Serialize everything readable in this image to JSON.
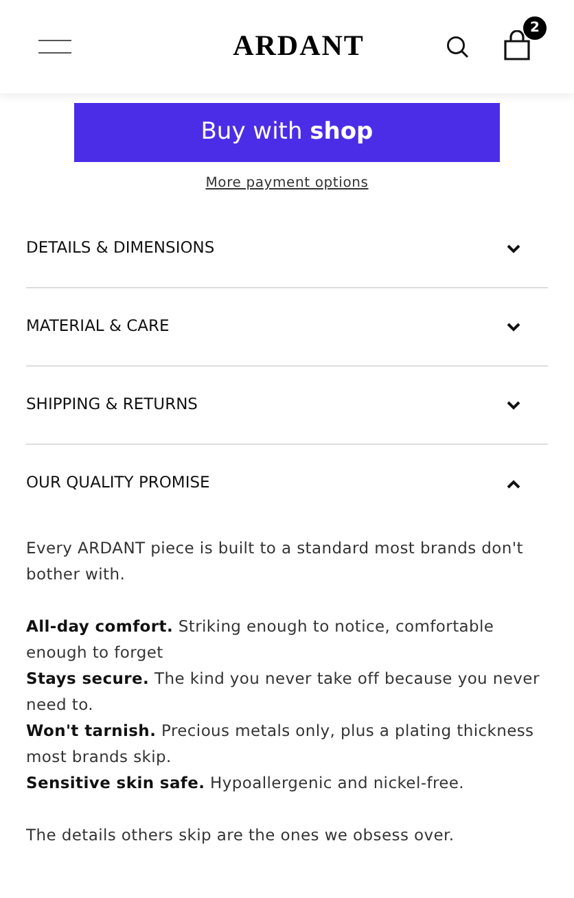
{
  "header": {
    "logo": "ARDANT",
    "cart_count": "2"
  },
  "buy_button": {
    "label": "Buy with **shop**"
  },
  "more_payment_link": "More payment options",
  "accordion": [
    {
      "title": "DETAILS & DIMENSIONS",
      "expanded": false
    },
    {
      "title": "MATERIAL & CARE",
      "expanded": false
    },
    {
      "title": "SHIPPING & RETURNS",
      "expanded": false
    },
    {
      "title": "OUR QUALITY PROMISE",
      "expanded": true,
      "intro": "Every ARDANT piece is built to a standard most brands don't bother with.",
      "points": [
        "**All-day comfort.** Striking enough to notice, comfortable enough to forget",
        "**Stays secure.** The kind you never take off because you never need to.",
        "**Won't tarnish.** Precious metals only, plus a plating thickness most brands skip.",
        "**Sensitive skin safe.** Hypoallergenic and nickel-free."
      ],
      "outro": "The details others skip are the ones we obsess over."
    }
  ]
}
